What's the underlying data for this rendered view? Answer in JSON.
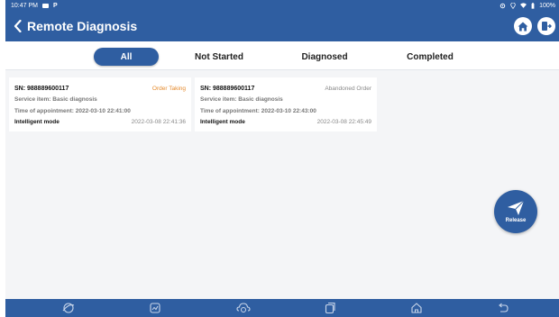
{
  "colors": {
    "primary": "#2f5ea1",
    "order_taking": "#e58a2c",
    "abandoned": "#888888",
    "background": "#f4f5f7"
  },
  "status_bar": {
    "time": "10:47 PM",
    "battery": "100%"
  },
  "header": {
    "title": "Remote Diagnosis",
    "icons": [
      "back-icon",
      "home-icon",
      "exit-icon"
    ]
  },
  "tabs": [
    {
      "label": "All",
      "active": true
    },
    {
      "label": "Not Started",
      "active": false
    },
    {
      "label": "Diagnosed",
      "active": false
    },
    {
      "label": "Completed",
      "active": false
    }
  ],
  "orders": [
    {
      "sn": "SN: 988889600117",
      "status": "Order Taking",
      "service_item": "Service item: Basic diagnosis",
      "appointment": "Time of appointment: 2022-03-10 22:41:00",
      "mode": "Intelligent mode",
      "date": "2022-03-08 22:41:36"
    },
    {
      "sn": "SN: 988889600117",
      "status": "Abandoned Order",
      "service_item": "Service item: Basic diagnosis",
      "appointment": "Time of appointment: 2022-03-10 22:43:00",
      "mode": "Intelligent mode",
      "date": "2022-03-08 22:45:49"
    }
  ],
  "release_button": {
    "label": "Release",
    "icon": "paper-plane-icon"
  },
  "nav_bar": {
    "icons": [
      "browser-icon",
      "screenshot-icon",
      "vci-icon",
      "recent-apps-icon",
      "home-icon",
      "back-icon"
    ]
  }
}
